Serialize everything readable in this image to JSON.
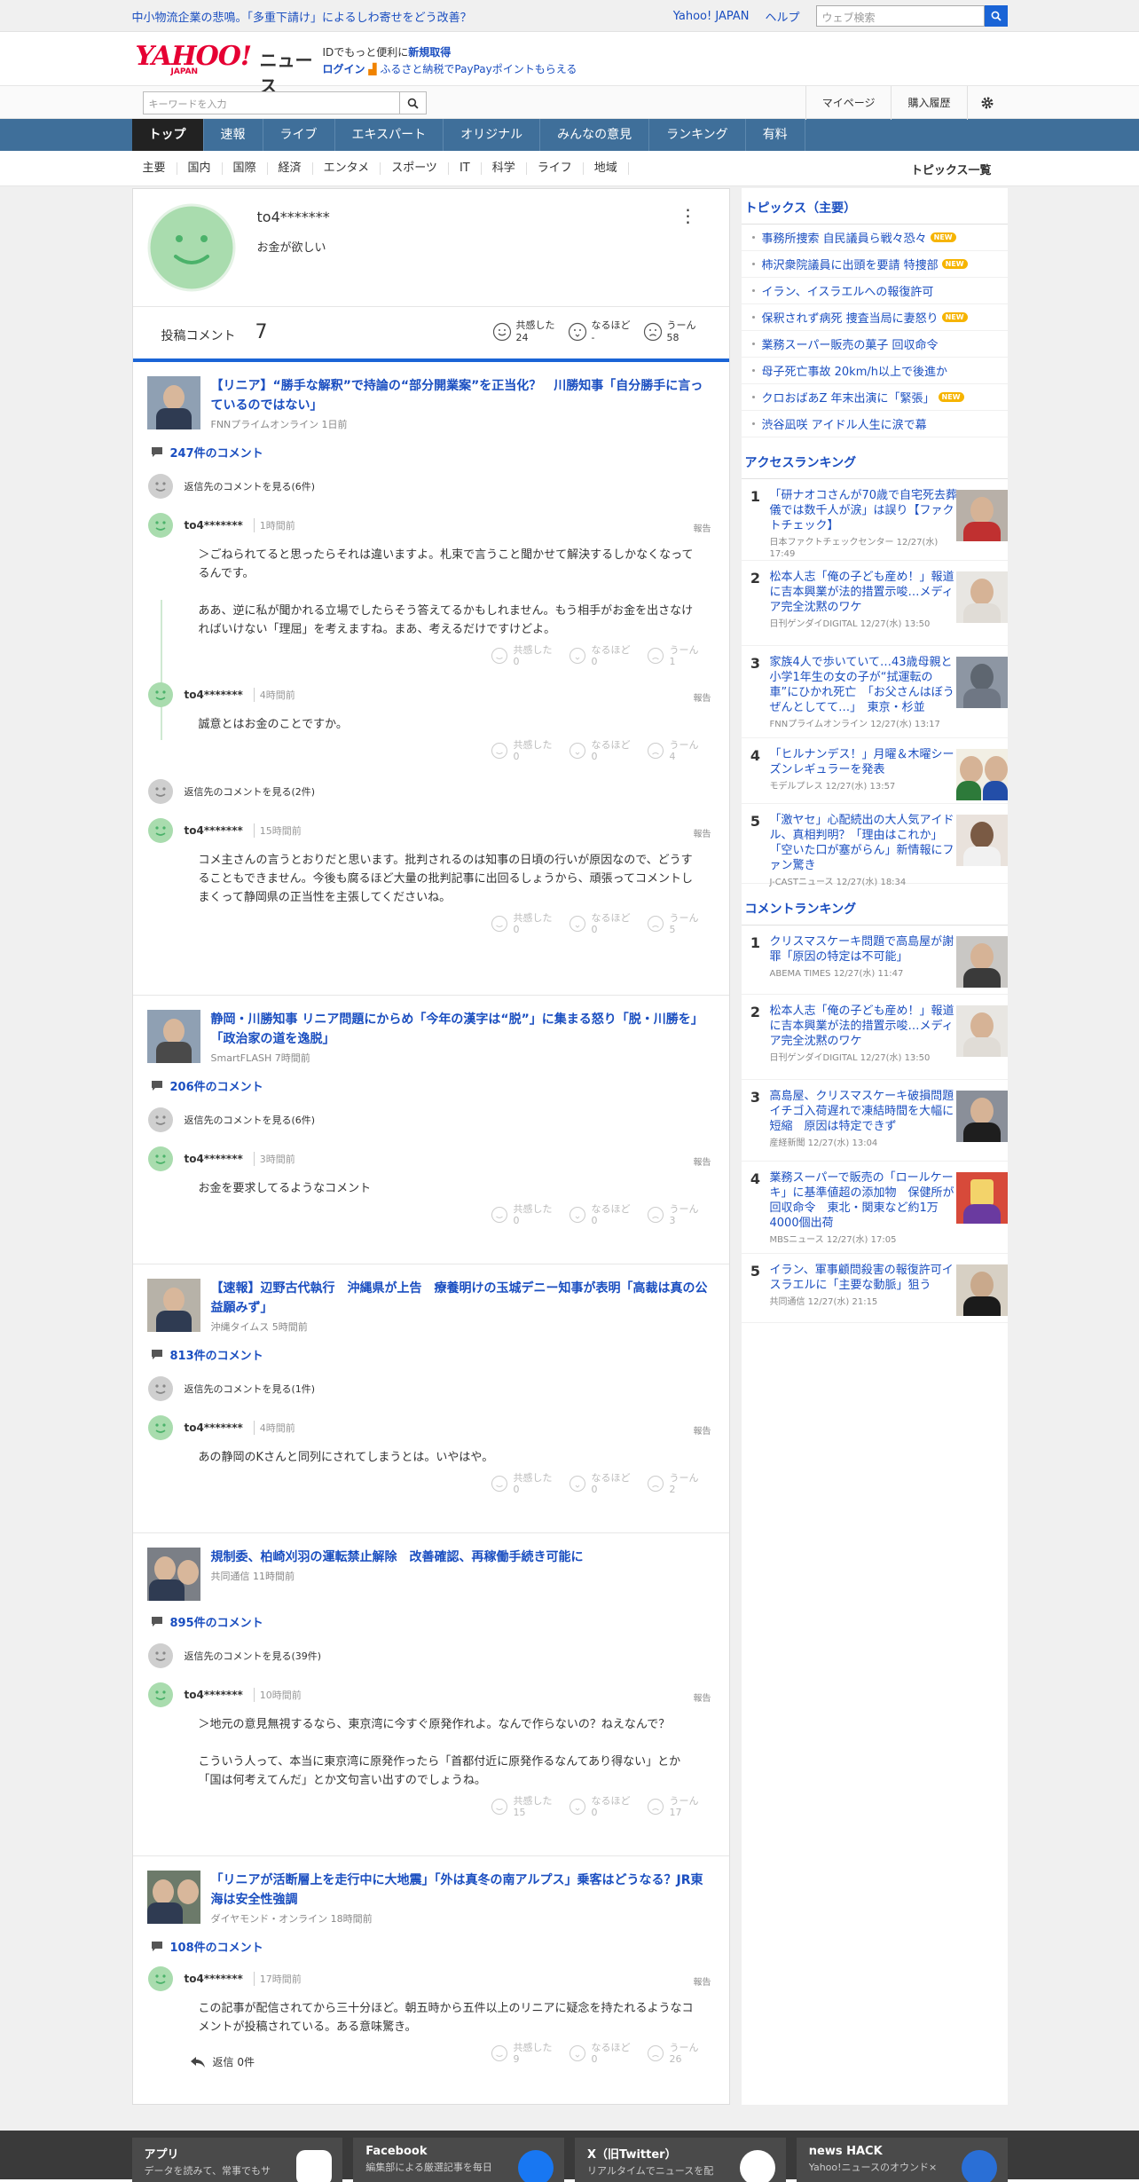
{
  "topbar": {
    "headline": "中小物流企業の悲鳴。「多重下請け」によるしわ寄せをどう改善？",
    "yahoo_japan": "Yahoo! JAPAN",
    "help": "ヘルプ",
    "web_search_placeholder": "ウェブ検索"
  },
  "header": {
    "logo_text": "YAHOO!",
    "logo_sub": "JAPAN",
    "section": "ニュース",
    "login_line1": "IDでもっと便利に",
    "login_line1_link": "新規取得",
    "login_link": "ログイン",
    "furusato": "ふるさと納税でPayPayポイントもらえる"
  },
  "searchbar": {
    "placeholder": "キーワードを入力",
    "mypage": "マイページ",
    "history": "購入履歴"
  },
  "gnav": [
    "トップ",
    "速報",
    "ライブ",
    "エキスパート",
    "オリジナル",
    "みんなの意見",
    "ランキング",
    "有料"
  ],
  "cnav": {
    "cats": [
      "主要",
      "国内",
      "国際",
      "経済",
      "エンタメ",
      "スポーツ",
      "IT",
      "科学",
      "ライフ",
      "地域"
    ],
    "more": "トピックス一覧"
  },
  "profile": {
    "name": "to4*******",
    "bio": "お金が欲しい",
    "posts_label": "投稿コメント",
    "posts_count": "7",
    "reactions": [
      {
        "label": "共感した",
        "value": "24"
      },
      {
        "label": "なるほど",
        "value": "-"
      },
      {
        "label": "うーん",
        "value": "58"
      }
    ]
  },
  "labels": {
    "report": "報告",
    "empathy": "共感した",
    "naruhodo": "なるほど",
    "uun": "うーん",
    "reply_zero": "返信 0件"
  },
  "articles": [
    {
      "title": "【リニア】“勝手な解釈”で持論の“部分開業案”を正当化？　川勝知事「自分勝手に言っているのではない」",
      "source": "FNNプライムオンライン 1日前",
      "comment_count": "247件のコメント",
      "reply_toggle": "返信先のコメントを見る(6件)",
      "comments": [
        {
          "name": "to4*******",
          "time": "1時間前",
          "body": "＞ごねられてると思ったらそれは違いますよ。札束で言うこと聞かせて解決するしかなくなってるんです。\n\nああ、逆に私が聞かれる立場でしたらそう答えてるかもしれません。もう相手がお金を出さなければいけない「理屈」を考えますね。まあ、考えるだけですけどよ。",
          "e": "0",
          "n": "0",
          "u": "1"
        },
        {
          "name": "to4*******",
          "time": "4時間前",
          "body": "誠意とはお金のことですか。",
          "e": "0",
          "n": "0",
          "u": "4"
        }
      ],
      "reply_toggle2": "返信先のコメントを見る(2件)",
      "comments2": [
        {
          "name": "to4*******",
          "time": "15時間前",
          "body": "コメ主さんの言うとおりだと思います。批判されるのは知事の日頃の行いが原因なので、どうすることもできません。今後も腐るほど大量の批判記事に出回るしょうから、頑張ってコメントしまくって静岡県の正当性を主張してくださいね。",
          "e": "0",
          "n": "0",
          "u": "5"
        }
      ]
    },
    {
      "title": "静岡・川勝知事 リニア問題にからめ「今年の漢字は“脱”」に集まる怒り「脱・川勝を」「政治家の道を逸脱」",
      "source": "SmartFLASH 7時間前",
      "comment_count": "206件のコメント",
      "reply_toggle": "返信先のコメントを見る(6件)",
      "comments": [
        {
          "name": "to4*******",
          "time": "3時間前",
          "body": "お金を要求してるようなコメント",
          "e": "0",
          "n": "0",
          "u": "3"
        }
      ]
    },
    {
      "title": "【速報】辺野古代執行　沖縄県が上告　療養明けの玉城デニー知事が表明「高裁は真の公益願みず」",
      "source": "沖縄タイムス 5時間前",
      "comment_count": "813件のコメント",
      "reply_toggle": "返信先のコメントを見る(1件)",
      "comments": [
        {
          "name": "to4*******",
          "time": "4時間前",
          "body": "あの静岡のKさんと同列にされてしまうとは。いやはや。",
          "e": "0",
          "n": "0",
          "u": "2"
        }
      ]
    },
    {
      "title": "規制委、柏崎刈羽の運転禁止解除　改善確認、再稼働手続き可能に",
      "source": "共同通信 11時間前",
      "comment_count": "895件のコメント",
      "reply_toggle": "返信先のコメントを見る(39件)",
      "comments": [
        {
          "name": "to4*******",
          "time": "10時間前",
          "body": "＞地元の意見無視するなら、東京湾に今すぐ原発作れよ。なんで作らないの？ねえなんで？\n\nこういう人って、本当に東京湾に原発作ったら「首都付近に原発作るなんてあり得ない」とか「国は何考えてんだ」とか文句言い出すのでしょうね。",
          "e": "15",
          "n": "0",
          "u": "17"
        }
      ]
    },
    {
      "title": "「リニアが活断層上を走行中に大地震」「外は真冬の南アルプス」乗客はどうなる？JR東海は安全性強調",
      "source": "ダイヤモンド・オンライン 18時間前",
      "comment_count": "108件のコメント",
      "comments": [
        {
          "name": "to4*******",
          "time": "17時間前",
          "body": "この記事が配信されてから三十分ほど。朝五時から五件以上のリニアに疑念を持たれるようなコメントが投稿されている。ある意味驚き。",
          "e": "9",
          "n": "0",
          "u": "26"
        }
      ]
    }
  ],
  "sidebar": {
    "topics_title": "トピックス（主要）",
    "new_badge": "NEW",
    "topics": [
      {
        "title": "事務所捜索 自民議員ら戦々恐々",
        "new": true
      },
      {
        "title": "柿沢衆院議員に出頭を要請 特捜部",
        "new": true
      },
      {
        "title": "イラン、イスラエルへの報復許可",
        "new": false
      },
      {
        "title": "保釈されず病死 捜査当局に妻怒り",
        "new": true
      },
      {
        "title": "業務スーパー販売の菓子 回収命令",
        "new": false
      },
      {
        "title": "母子死亡事故 20km/h以上で後進か",
        "new": false
      },
      {
        "title": "クロおばあZ 年末出演に「緊張」",
        "new": true
      },
      {
        "title": "渋谷凪咲 アイドル人生に涙で幕",
        "new": false
      }
    ],
    "access_title": "アクセスランキング",
    "access": [
      {
        "rank": "1",
        "title": "「研ナオコさんが70歳で自宅死去葬儀では数千人が涙」は誤り【ファクトチェック】",
        "meta": "日本ファクトチェックセンター 12/27(水) 17:49"
      },
      {
        "rank": "2",
        "title": "松本人志「俺の子ども産め！」報道に吉本興業が法的措置示唆…メディア完全沈黙のワケ",
        "meta": "日刊ゲンダイDIGITAL 12/27(水) 13:50"
      },
      {
        "rank": "3",
        "title": "家族4人で歩いていて…43歳母親と小学1年生の女の子が“拭運転の車”にひかれ死亡　「お父さんはぼうぜんとしてて…」　東京・杉並",
        "meta": "FNNプライムオンライン 12/27(水) 13:17"
      },
      {
        "rank": "4",
        "title": "「ヒルナンデス！」月曜＆木曜シーズンレギュラーを発表",
        "meta": "モデルプレス 12/27(水) 13:57"
      },
      {
        "rank": "5",
        "title": "「激ヤセ」心配続出の大人気アイドル、真相判明？「理由はこれか」「空いた口が塞がらん」新情報にファン驚き",
        "meta": "J-CASTニュース 12/27(水) 18:34"
      }
    ],
    "comment_title": "コメントランキング",
    "comment_rank": [
      {
        "rank": "1",
        "title": "クリスマスケーキ問題で高島屋が謝罪「原因の特定は不可能」",
        "meta": "ABEMA TIMES 12/27(水) 11:47"
      },
      {
        "rank": "2",
        "title": "松本人志「俺の子ども産め！」報道に吉本興業が法的措置示唆…メディア完全沈黙のワケ",
        "meta": "日刊ゲンダイDIGITAL 12/27(水) 13:50"
      },
      {
        "rank": "3",
        "title": "高島屋、クリスマスケーキ破損問題　イチゴ入荷遅れで凍結時間を大幅に短縮　原因は特定できず",
        "meta": "産経新聞 12/27(水) 13:04"
      },
      {
        "rank": "4",
        "title": "業務スーパーで販売の「ロールケーキ」に基準値超の添加物　保健所が回収命令　東北・関東など約1万4000個出荷",
        "meta": "MBSニュース 12/27(水) 17:05"
      },
      {
        "rank": "5",
        "title": "イラン、軍事顧問殺害の報復許可イスラエルに「主要な動脈」狙う",
        "meta": "共同通信 12/27(水) 21:15"
      }
    ]
  },
  "footer": [
    {
      "title": "アプリ",
      "desc": "データを読みて、常事でもサ"
    },
    {
      "title": "Facebook",
      "desc": "編集部による厳選記事を毎日"
    },
    {
      "title": "X（旧Twitter）",
      "desc": "リアルタイムでニュースを配"
    },
    {
      "title": "news HACK",
      "desc": "Yahoo!ニュースのオウンド×"
    }
  ],
  "colors": {
    "brand": "#e60033",
    "link": "#1a4ec0",
    "nav": "#3f6f9a",
    "face": "#a9dcae"
  }
}
